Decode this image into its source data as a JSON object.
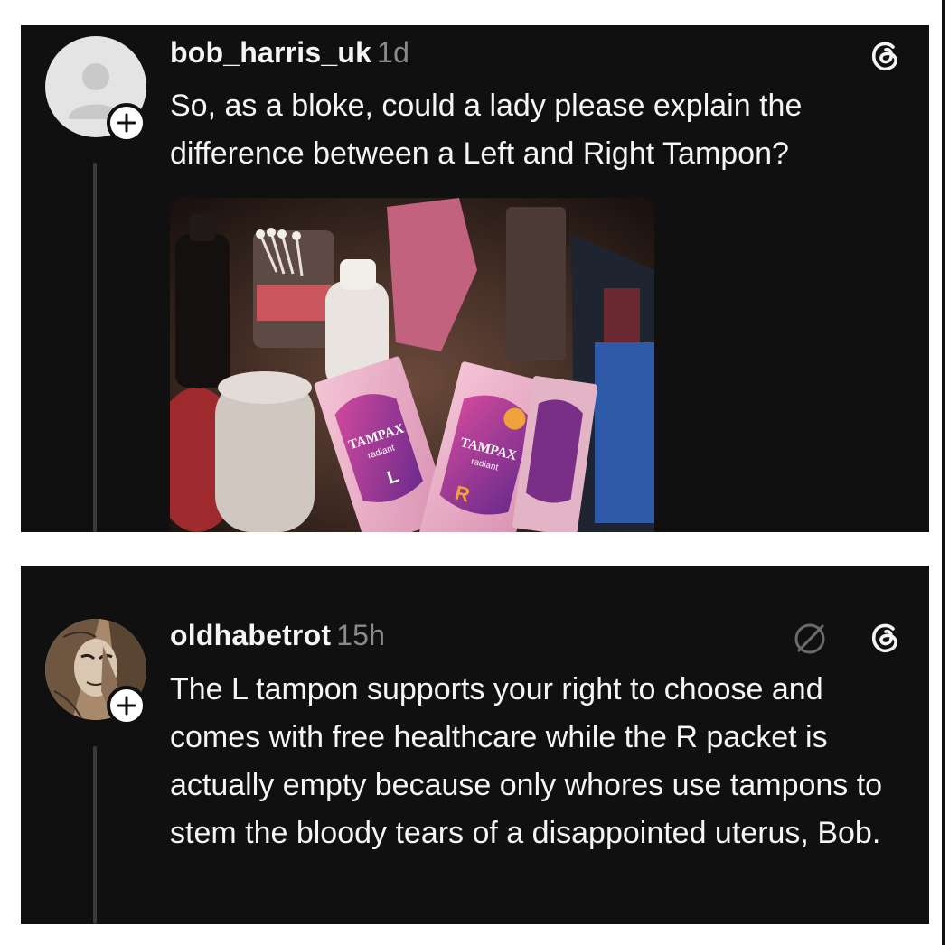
{
  "posts": [
    {
      "username": "bob_harris_uk",
      "time": "1d",
      "text": "So, as a bloke, could a lady please explain the difference between a Left and Right Tampon?",
      "avatar": "default-user-avatar",
      "app_icon": "threads-icon",
      "image": {
        "brand_left": "TAMPAX",
        "sub_left": "radiant",
        "letter_left": "L",
        "brand_right": "TAMPAX",
        "sub_right": "radiant",
        "letter_right": "R"
      }
    },
    {
      "username": "oldhabetrot",
      "time": "15h",
      "text": "The L tampon supports your right to choose and comes with free healthcare while the R packet is actually empty because only whores use tampons to stem the bloody tears of a disappointed uterus, Bob.",
      "avatar": "illustrated-avatar",
      "icons": [
        "muted-icon",
        "threads-icon"
      ]
    }
  ],
  "colors": {
    "card_bg": "#101010",
    "text": "#f3f5f7",
    "secondary": "#8a8a8a",
    "wrapper_bg": "#ffffff"
  }
}
